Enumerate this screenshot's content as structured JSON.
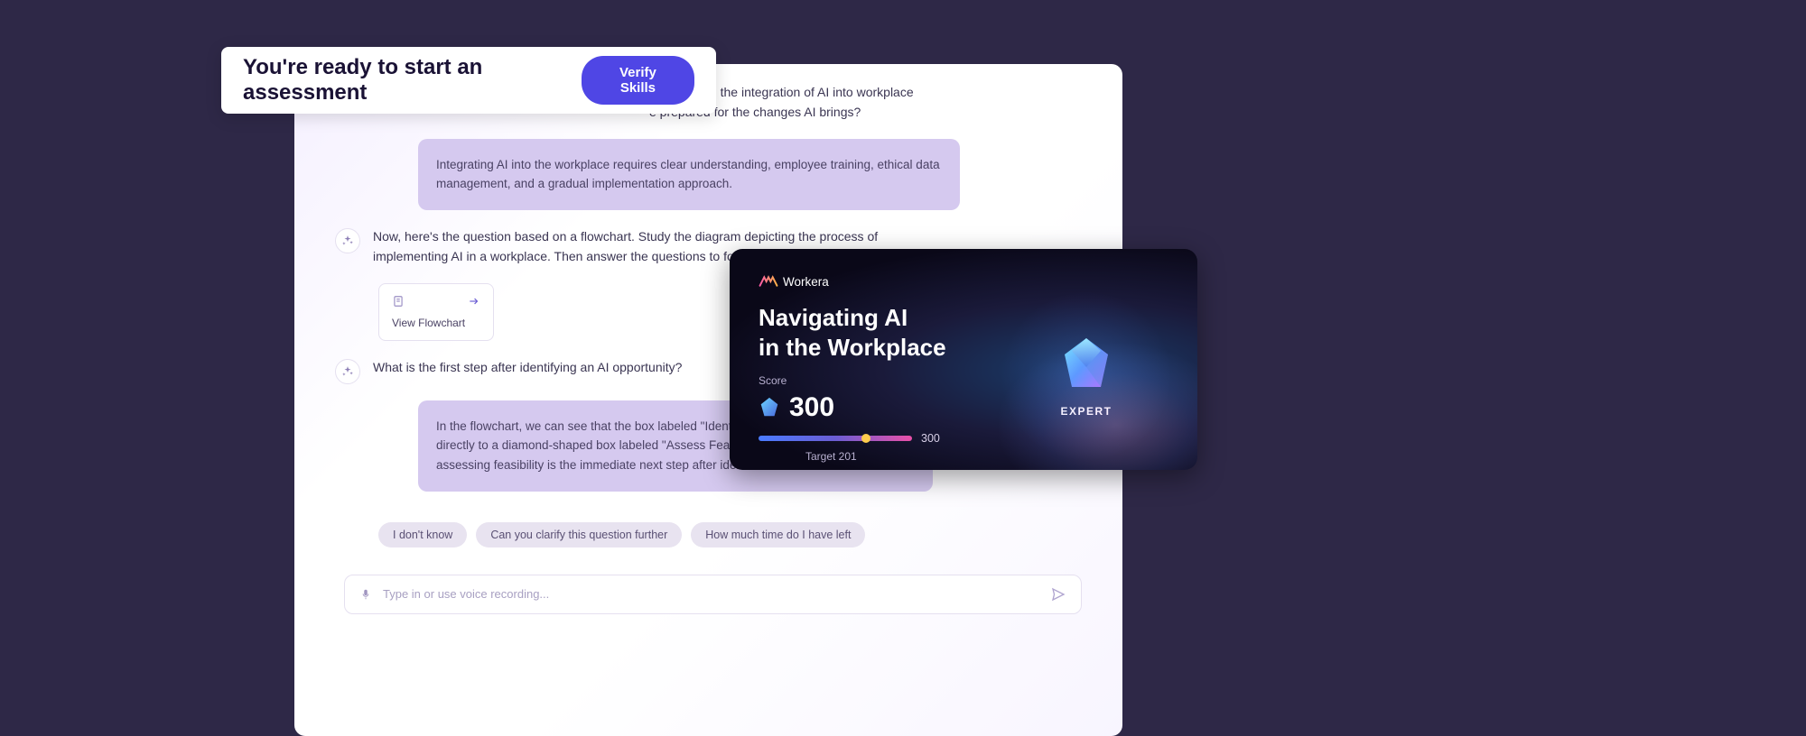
{
  "banner": {
    "title": "You're ready to start an assessment",
    "button": "Verify Skills"
  },
  "chat": {
    "top_lines": {
      "l1": "y navigating the integration of AI into workplace",
      "l2": "e prepared for the changes AI brings?"
    },
    "highlight1": "Integrating AI into the workplace requires clear understanding, employee training, ethical data management, and a gradual implementation approach.",
    "msg1": "Now, here's the question based on a flowchart. Study the diagram depicting the process of implementing AI in a workplace. Then answer the questions to follow:",
    "flowchart_label": "View Flowchart",
    "msg2": "What is the first step after identifying an AI opportunity?",
    "highlight2": "In the flowchart, we can see that the box labeled \"Identify AI Opportunity\" (A) points directly to a diamond-shaped box labeled \"Assess Feasibility\" (B). This indicates that assessing feasibility is the immediate next step after identification.",
    "chips": {
      "c1": "I don't know",
      "c2": "Can you clarify this question further",
      "c3": "How much time do I have left"
    },
    "input_placeholder": "Type in or use voice recording..."
  },
  "score": {
    "logo": "Workera",
    "title_l1": "Navigating AI",
    "title_l2": "in the Workplace",
    "score_label": "Score",
    "score_value": "300",
    "progress_max": "300",
    "target": "Target 201",
    "level": "EXPERT"
  }
}
